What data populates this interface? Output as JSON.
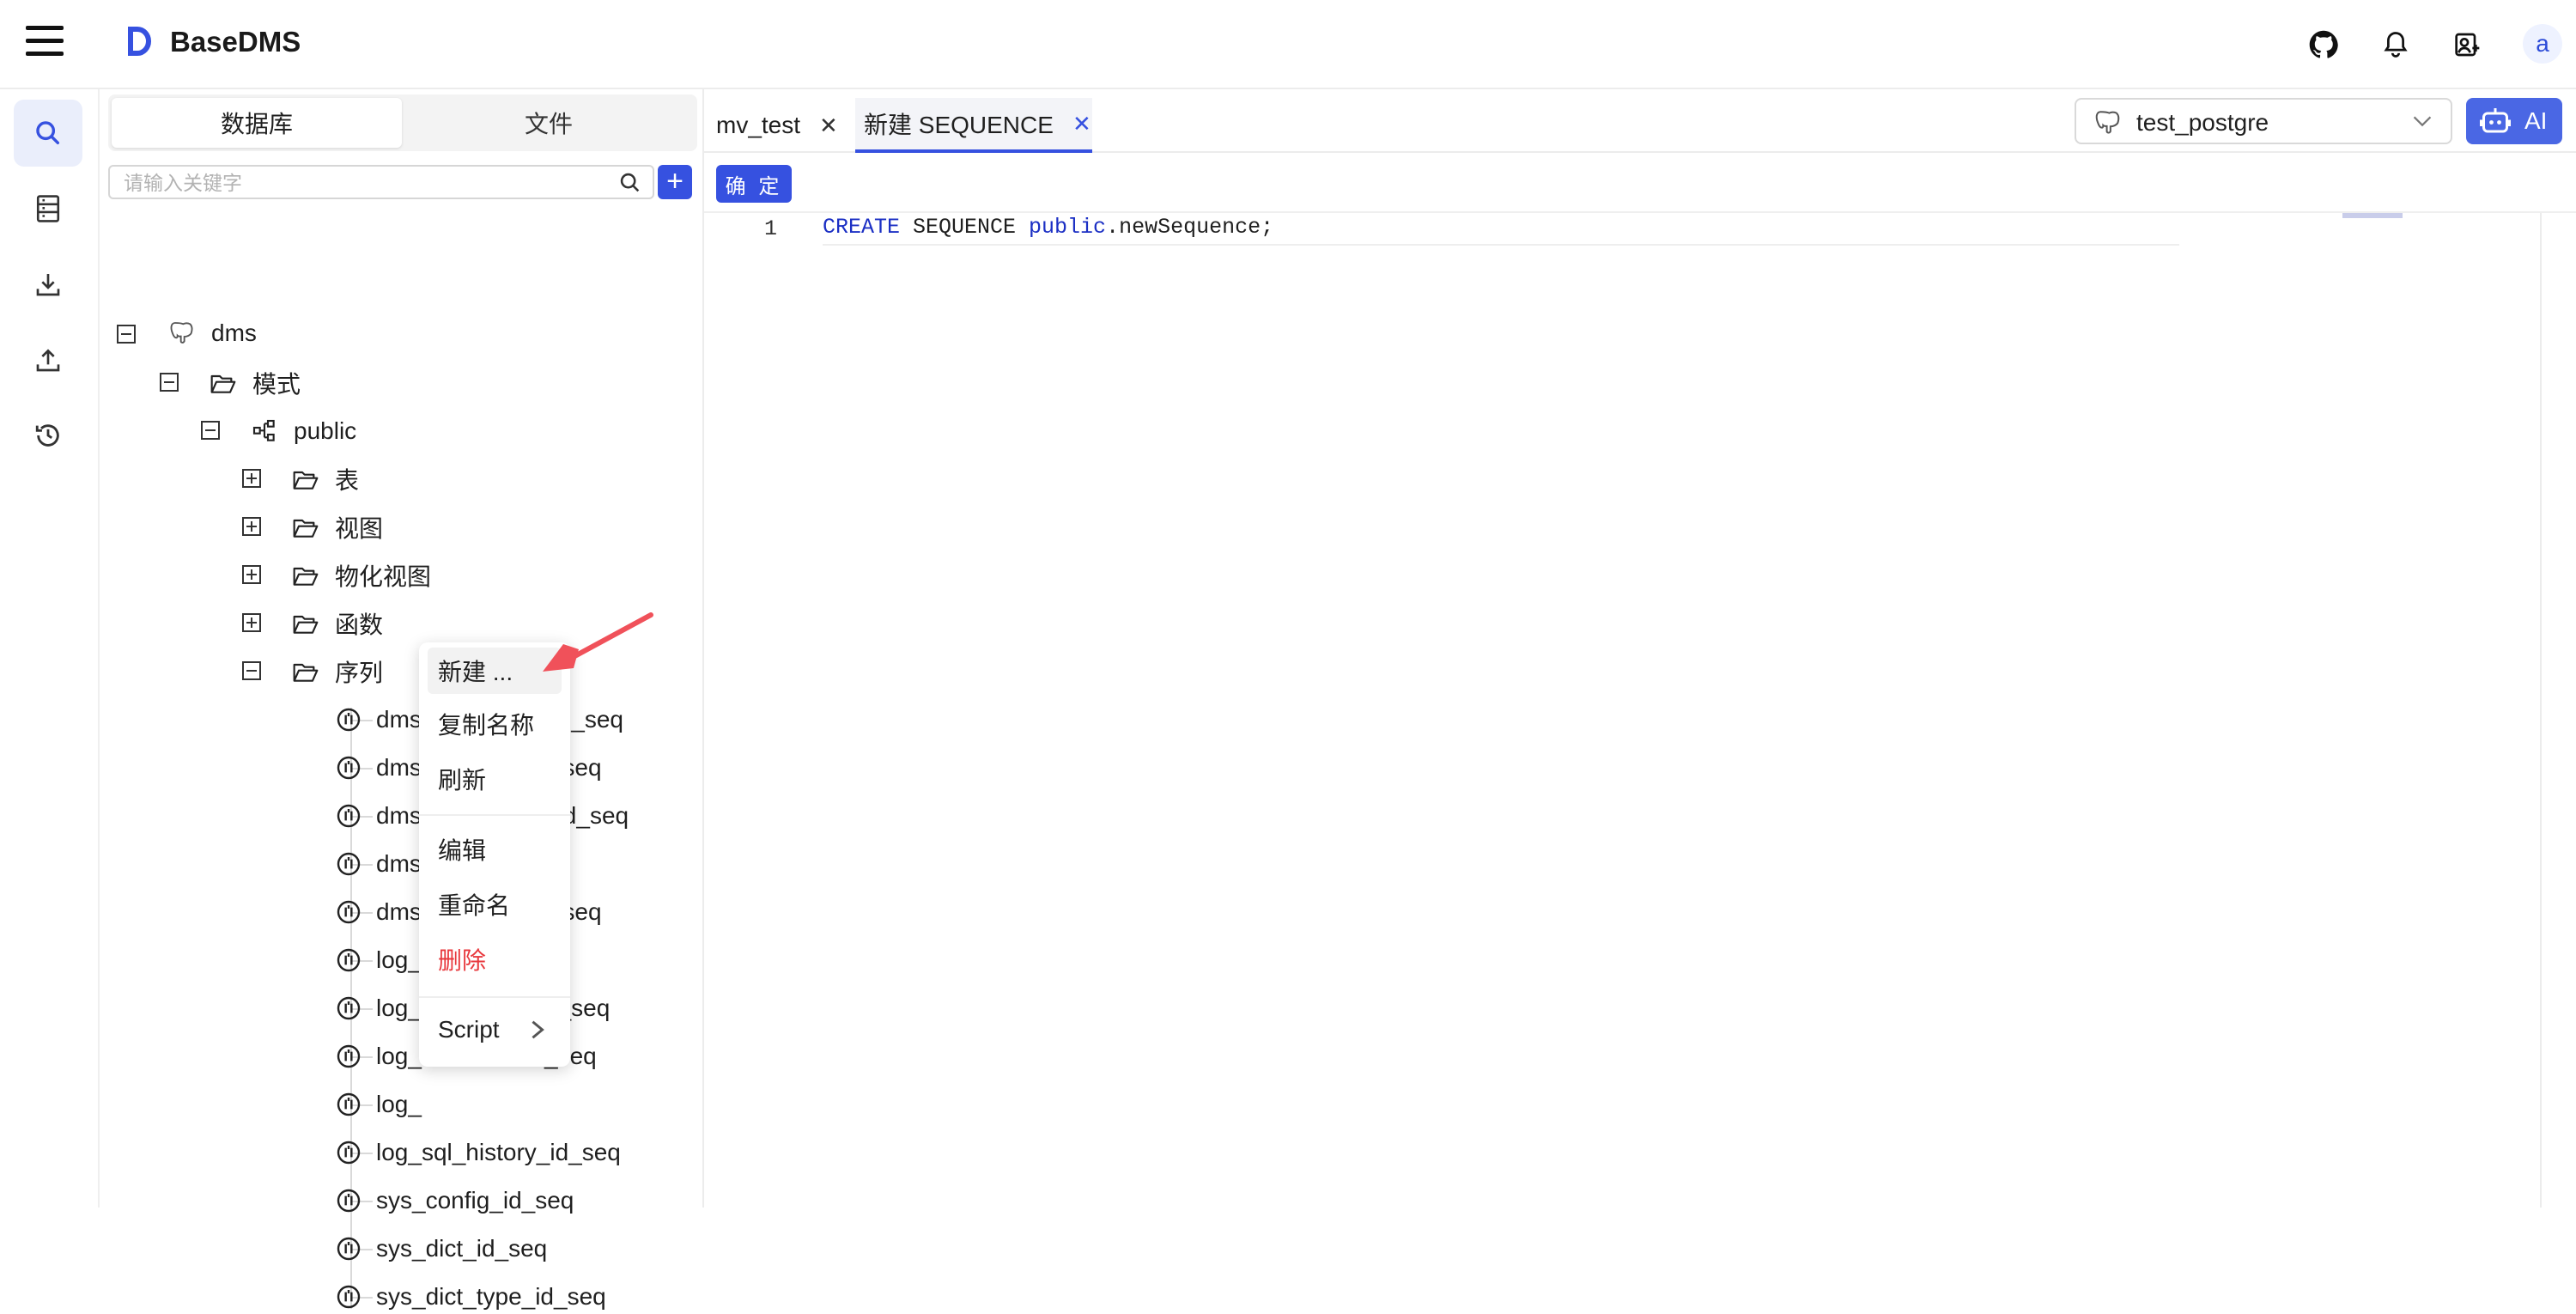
{
  "header": {
    "app_title": "BaseDMS",
    "avatar_letter": "a",
    "icons": [
      "github-icon",
      "bell-icon",
      "user-settings-icon"
    ]
  },
  "rail": {
    "items": [
      "search-icon",
      "database-list-icon",
      "download-icon",
      "upload-icon",
      "history-icon"
    ],
    "active": "search-icon"
  },
  "sidebar": {
    "tabs": [
      "数据库",
      "文件"
    ],
    "active_tab": "数据库",
    "search_placeholder": "请输入关键字",
    "search_value": "",
    "tree": {
      "root": "dms",
      "schema_folder": "模式",
      "schema": "public",
      "folders": [
        "表",
        "视图",
        "物化视图",
        "函数",
        "序列"
      ],
      "sequences": [
        "dms_data_task_id_seq",
        "dms",
        "dms",
        "dms",
        "dms",
        "log_",
        "log_",
        "log_",
        "log_",
        "log_sql_history_id_seq",
        "sys_config_id_seq",
        "sys_dict_id_seq",
        "sys_dict_type_id_seq"
      ],
      "sequence_suffixes": [
        "",
        "id_seq",
        "_id_seq",
        "",
        "id_seq",
        "q",
        "d_seq",
        "_seq",
        "",
        "",
        "",
        "",
        ""
      ]
    }
  },
  "context_menu": {
    "items": [
      "新建 ...",
      "复制名称",
      "刷新",
      "编辑",
      "重命名",
      "删除",
      "Script"
    ]
  },
  "tabs": [
    {
      "label": "mv_test"
    },
    {
      "label": "新建 SEQUENCE",
      "active": true
    }
  ],
  "connection": {
    "selected": "test_postgre"
  },
  "ai_label": "AI",
  "toolbar": {
    "ok_label": "确 定"
  },
  "editor": {
    "line_number": "1",
    "code_kw1": "CREATE",
    "code_mid": " SEQUENCE ",
    "code_kw2": "public",
    "code_tail": ".newSequence;"
  },
  "colors": {
    "accent": "#3651e0",
    "danger": "#e8383d",
    "keyword": "#1b2fc4",
    "annotation_arrow": "#f0515a"
  }
}
